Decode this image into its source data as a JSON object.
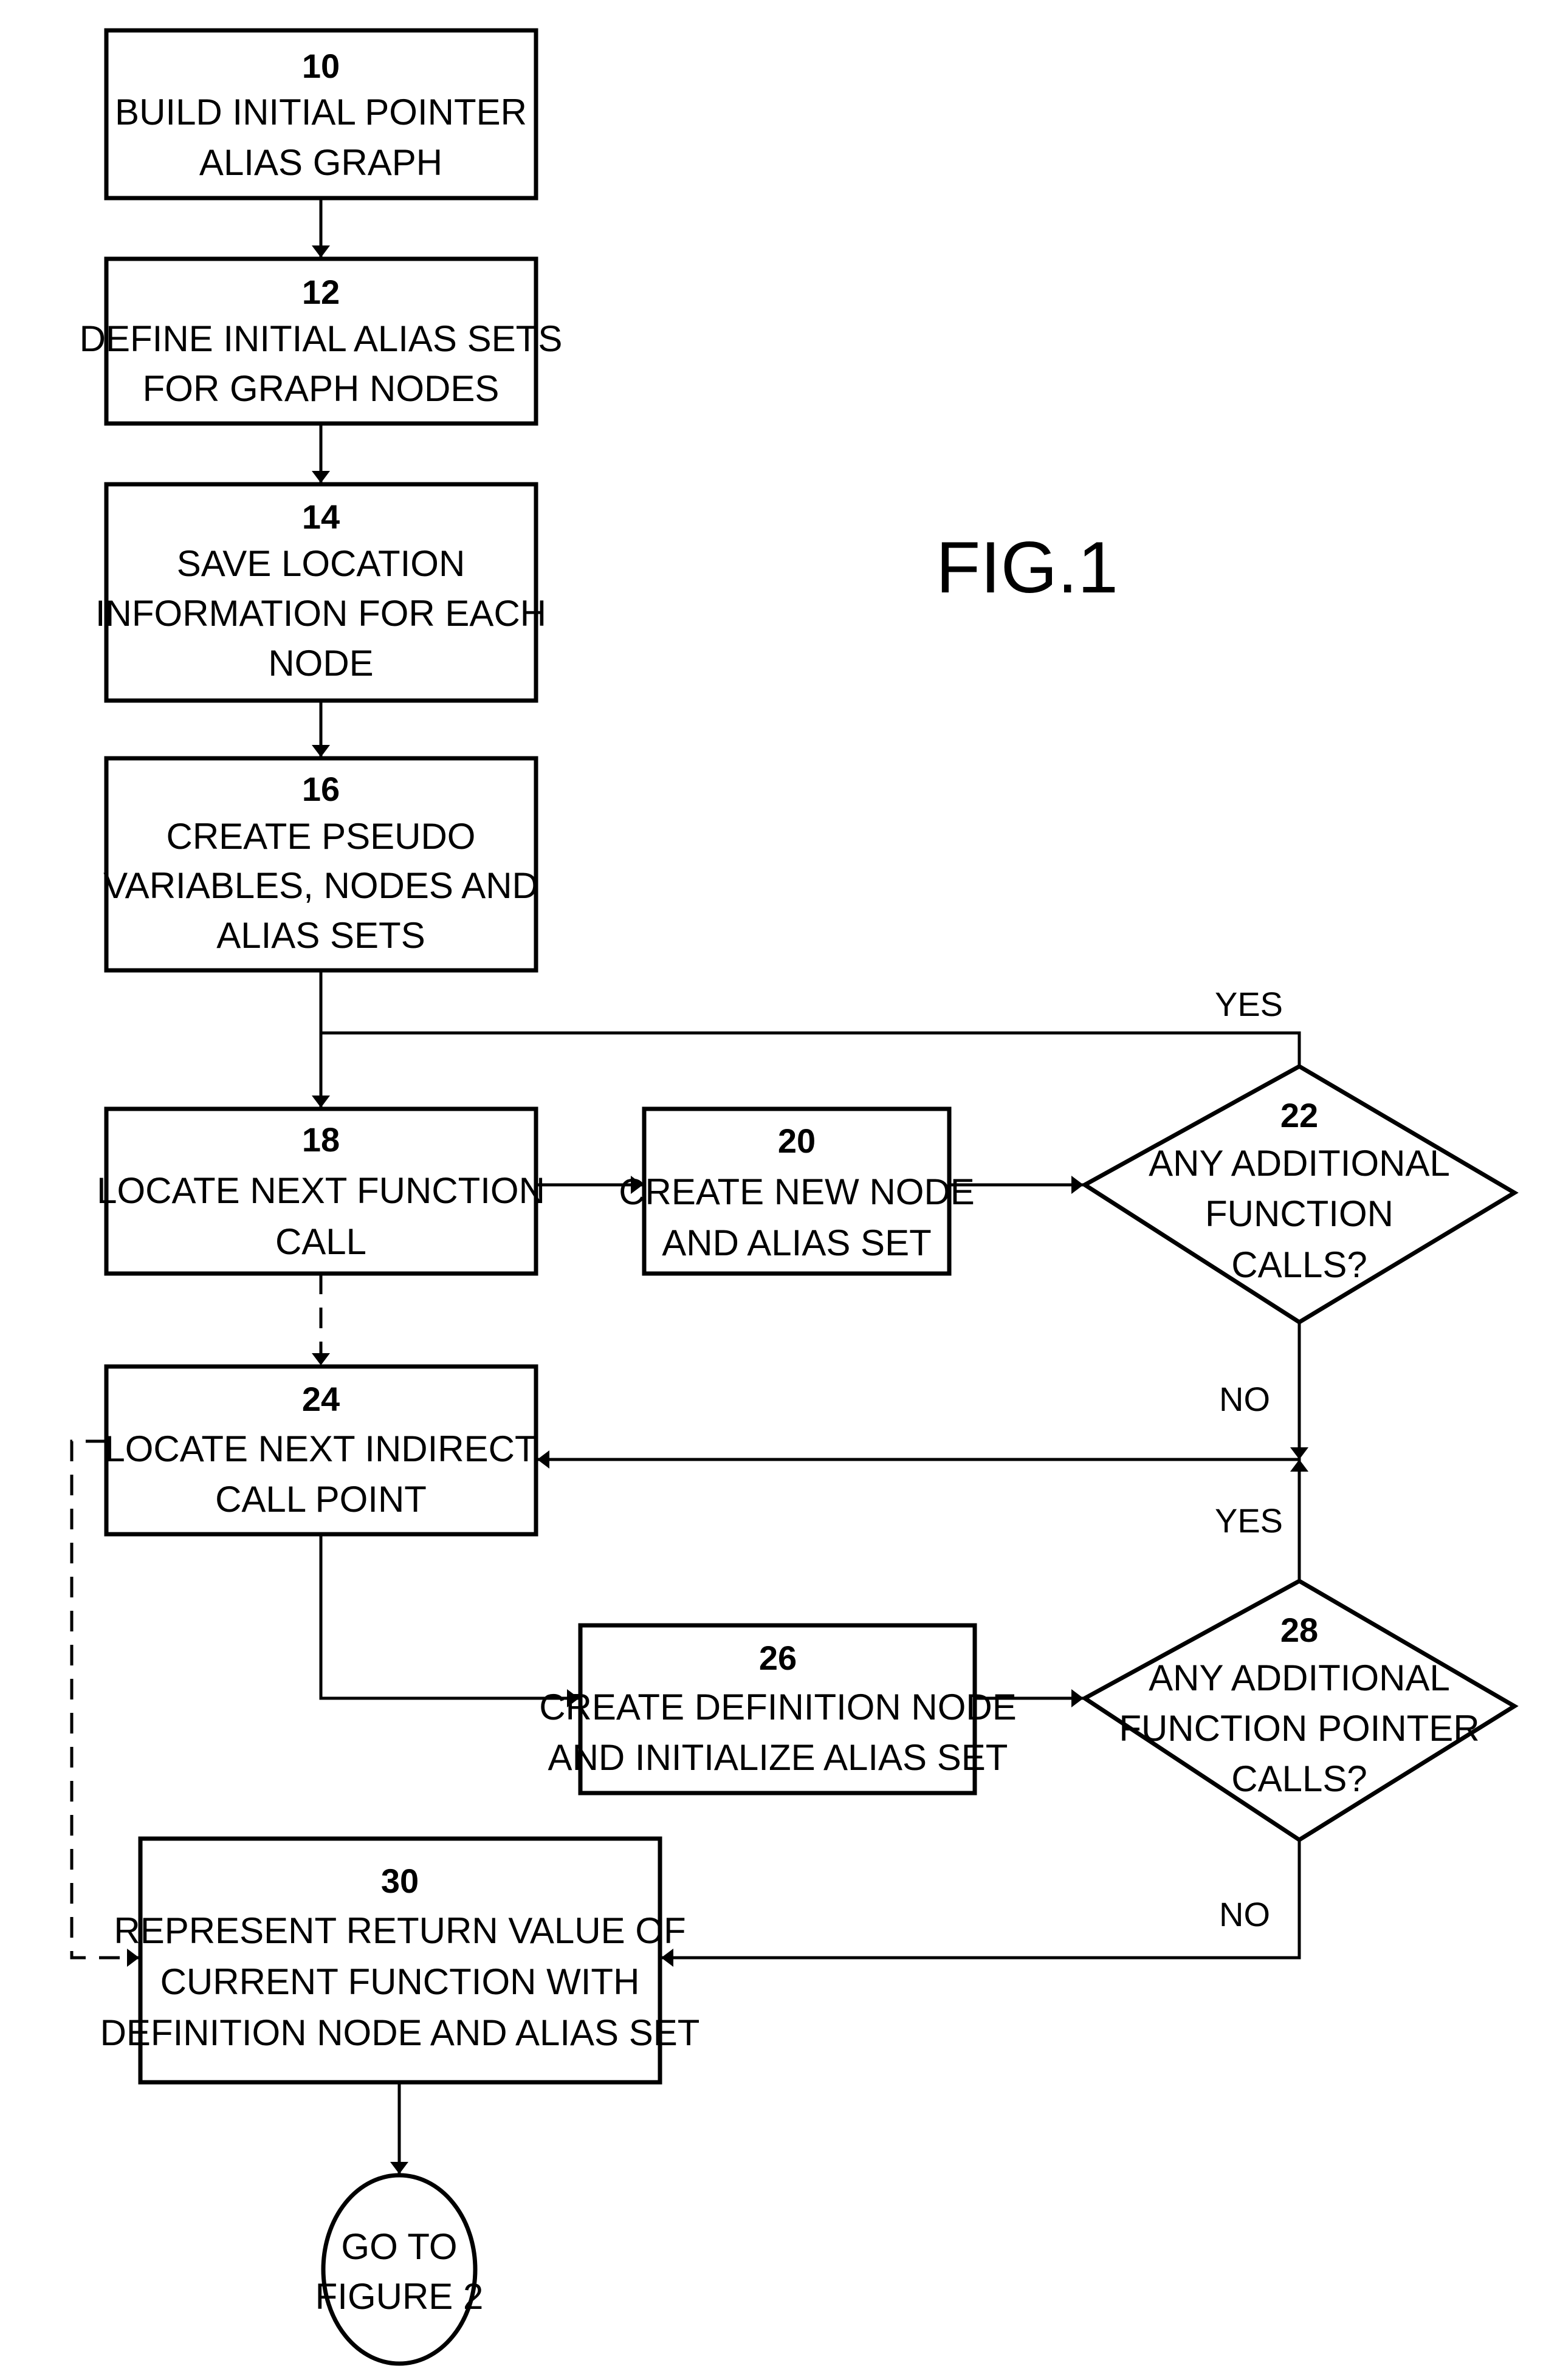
{
  "figure_label": "FIG.1",
  "nodes": {
    "n10": {
      "number": "10",
      "lines": [
        "BUILD INITIAL POINTER",
        "ALIAS GRAPH"
      ]
    },
    "n12": {
      "number": "12",
      "lines": [
        "DEFINE INITIAL ALIAS SETS",
        "FOR GRAPH NODES"
      ]
    },
    "n14": {
      "number": "14",
      "lines": [
        "SAVE LOCATION",
        "INFORMATION FOR EACH",
        "NODE"
      ]
    },
    "n16": {
      "number": "16",
      "lines": [
        "CREATE PSEUDO",
        "VARIABLES, NODES AND",
        "ALIAS SETS"
      ]
    },
    "n18": {
      "number": "18",
      "lines": [
        "LOCATE NEXT FUNCTION",
        "CALL"
      ]
    },
    "n20": {
      "number": "20",
      "lines": [
        "CREATE NEW NODE",
        "AND ALIAS SET"
      ]
    },
    "n22": {
      "number": "22",
      "lines": [
        "ANY ADDITIONAL",
        "FUNCTION",
        "CALLS?"
      ]
    },
    "n24": {
      "number": "24",
      "lines": [
        "LOCATE NEXT INDIRECT",
        "CALL POINT"
      ]
    },
    "n26": {
      "number": "26",
      "lines": [
        "CREATE DEFINITION NODE",
        "AND INITIALIZE ALIAS SET"
      ]
    },
    "n28": {
      "number": "28",
      "lines": [
        "ANY ADDITIONAL",
        "FUNCTION POINTER",
        "CALLS?"
      ]
    },
    "n30": {
      "number": "30",
      "lines": [
        "REPRESENT RETURN VALUE OF",
        "CURRENT FUNCTION WITH",
        "DEFINITION NODE AND ALIAS SET"
      ]
    },
    "terminator": {
      "lines": [
        "GO TO",
        "FIGURE 2"
      ]
    }
  },
  "edge_labels": {
    "n22_yes": "YES",
    "n22_no": "NO",
    "n28_yes": "YES",
    "n28_no": "NO"
  }
}
